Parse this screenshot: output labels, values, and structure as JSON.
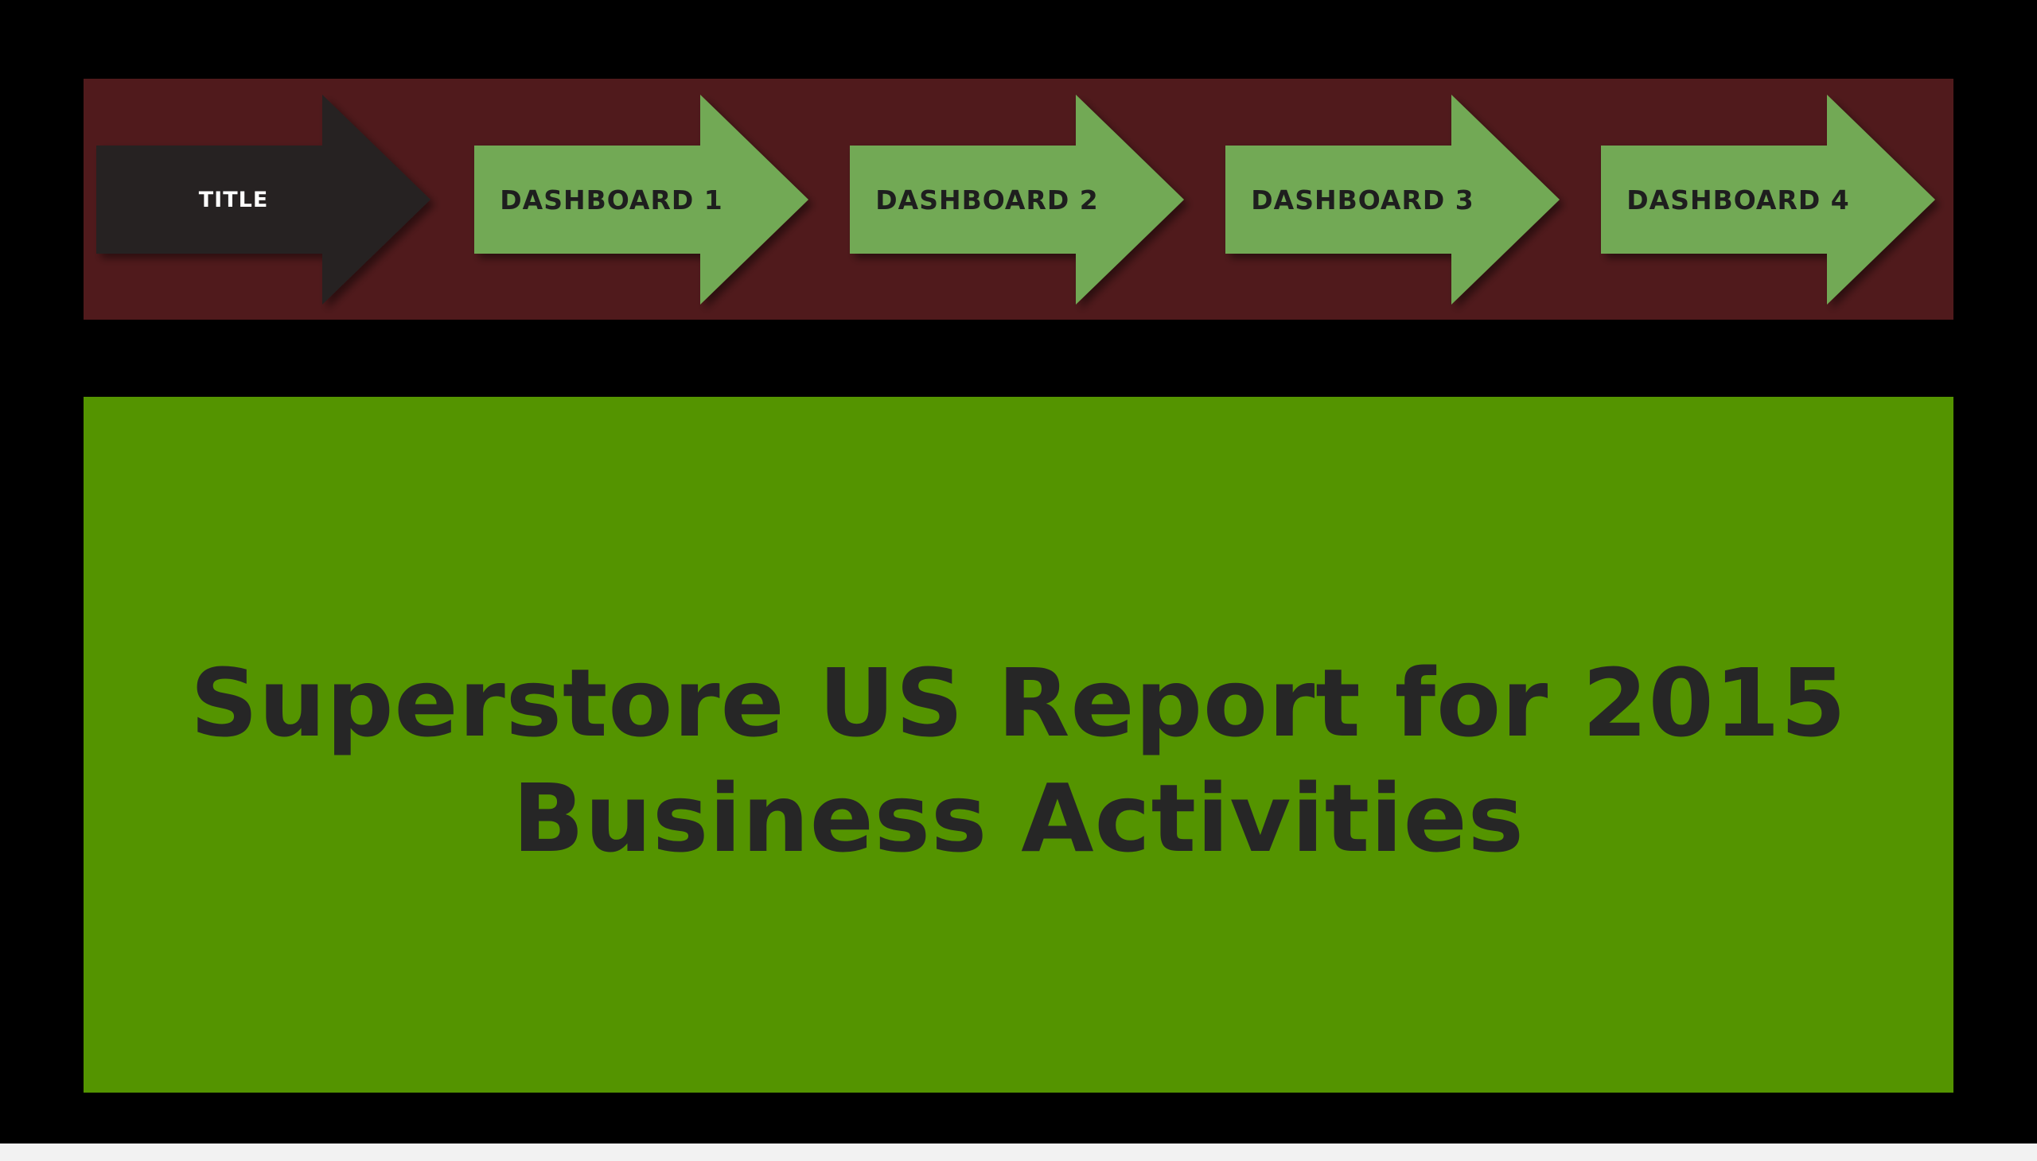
{
  "nav": {
    "items": [
      {
        "label": "TITLE",
        "active": true
      },
      {
        "label": "DASHBOARD 1",
        "active": false
      },
      {
        "label": "DASHBOARD 2",
        "active": false
      },
      {
        "label": "DASHBOARD 3",
        "active": false
      },
      {
        "label": "DASHBOARD 4",
        "active": false
      }
    ]
  },
  "title_panel": {
    "line1": "Superstore US Report for 2015",
    "line2": "Business Activities"
  },
  "colors": {
    "background": "#000000",
    "nav_bar": "#501a1c",
    "active_arrow": "#262424",
    "inactive_arrow": "#72a955",
    "title_panel": "#549400",
    "title_text": "#262626"
  }
}
